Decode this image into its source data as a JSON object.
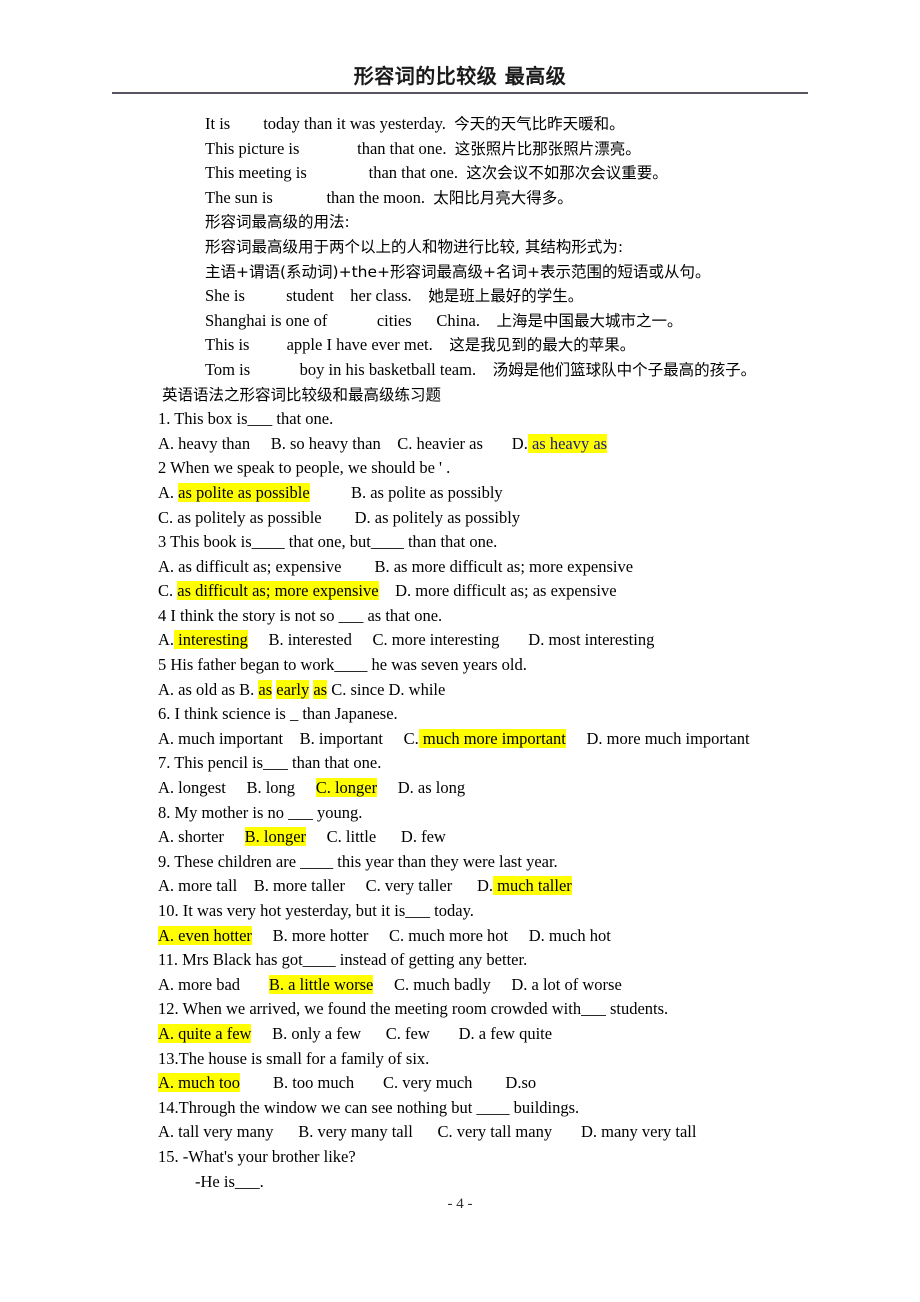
{
  "document": {
    "title": "形容词的比较级  最高级",
    "footer": "- 4 -"
  },
  "examples_comparative": [
    {
      "en_pre": "It is",
      "blank": "        ",
      "en_post": "today than it was yesterday.",
      "zh": "今天的天气比昨天暖和。"
    },
    {
      "en_pre": "This picture is",
      "blank": "              ",
      "en_post": "than that one.",
      "zh": "这张照片比那张照片漂亮。"
    },
    {
      "en_pre": "This meeting is",
      "blank": "               ",
      "en_post": "than that one.",
      "zh": "这次会议不如那次会议重要。"
    },
    {
      "en_pre": "The sun is",
      "blank": "             ",
      "en_post": "than the moon.",
      "zh": "太阳比月亮大得多。"
    }
  ],
  "notes": [
    "形容词最高级的用法:",
    "形容词最高级用于两个以上的人和物进行比较, 其结构形式为:",
    "主语+谓语(系动词)+the+形容词最高级+名词+表示范围的短语或从句。"
  ],
  "examples_superlative": [
    {
      "en_pre": "She is",
      "blank": "          ",
      "en_mid": "student",
      "blank2": "    ",
      "en_post": "her class.",
      "zh": "她是班上最好的学生。"
    },
    {
      "en_pre": "Shanghai is one of",
      "blank": "            ",
      "en_mid": "cities",
      "blank2": "      ",
      "en_post": "China.",
      "zh": "上海是中国最大城市之一。"
    },
    {
      "en_pre": "This is",
      "blank": "         ",
      "en_mid": "apple I have ever met.",
      "blank2": "",
      "en_post": "",
      "zh": "这是我见到的最大的苹果。"
    },
    {
      "en_pre": "Tom is",
      "blank": "            ",
      "en_mid": "boy in his basketball team.",
      "blank2": "",
      "en_post": "",
      "zh": "汤姆是他们篮球队中个子最高的孩子。"
    }
  ],
  "exercise_heading": "英语语法之形容词比较级和最高级练习题",
  "questions": [
    {
      "stem": "1. This box is___ that one.",
      "options_line": [
        {
          "text": "A. heavy than",
          "hl": "none"
        },
        {
          "text": "     ",
          "hl": "none"
        },
        {
          "text": "B. so heavy than",
          "hl": "none"
        },
        {
          "text": "    ",
          "hl": "none"
        },
        {
          "text": "C. heavier as",
          "hl": "none"
        },
        {
          "text": "       ",
          "hl": "none"
        },
        {
          "text": "D.",
          "hl": "none"
        },
        {
          "text": " as heavy as",
          "hl": "blue"
        }
      ]
    },
    {
      "stem": "2 When we speak to people, we should be ' .",
      "options_line": [
        {
          "text": "A. ",
          "hl": "none"
        },
        {
          "text": "as polite as possible",
          "hl": "yellow"
        },
        {
          "text": "          ",
          "hl": "none"
        },
        {
          "text": "B. as polite as possibly",
          "hl": "none"
        }
      ]
    },
    {
      "stem": "",
      "options_line": [
        {
          "text": "C. as politely as possible",
          "hl": "none"
        },
        {
          "text": "        ",
          "hl": "none"
        },
        {
          "text": "D. as politely as possibly",
          "hl": "none"
        }
      ]
    },
    {
      "stem": "3 This book is____ that one, but____ than that one.",
      "options_line": [
        {
          "text": "A. as difficult as; expensive",
          "hl": "none"
        },
        {
          "text": "        ",
          "hl": "none"
        },
        {
          "text": "B. as more difficult as; more expensive",
          "hl": "none"
        }
      ]
    },
    {
      "stem": "",
      "options_line": [
        {
          "text": "C. ",
          "hl": "none"
        },
        {
          "text": "as difficult as; more expensive",
          "hl": "yellow"
        },
        {
          "text": "    ",
          "hl": "none"
        },
        {
          "text": "D. more difficult as; as expensive",
          "hl": "none"
        }
      ]
    },
    {
      "stem": "4 I think the story is not so ___ as that one.",
      "options_line": [
        {
          "text": "A.",
          "hl": "none"
        },
        {
          "text": " interesting",
          "hl": "yellow"
        },
        {
          "text": "     ",
          "hl": "none"
        },
        {
          "text": "B. interested",
          "hl": "none"
        },
        {
          "text": "     ",
          "hl": "none"
        },
        {
          "text": "C. more interesting",
          "hl": "none"
        },
        {
          "text": "       ",
          "hl": "none"
        },
        {
          "text": "D. most interesting",
          "hl": "none"
        }
      ]
    },
    {
      "stem": "5 His father began to work____ he was seven years old.",
      "options_line": [
        {
          "text": "A. as old as B. ",
          "hl": "none"
        },
        {
          "text": "as",
          "hl": "yellow"
        },
        {
          "text": " ",
          "hl": "none"
        },
        {
          "text": "early",
          "hl": "yellow"
        },
        {
          "text": " ",
          "hl": "none"
        },
        {
          "text": "as",
          "hl": "yellow"
        },
        {
          "text": " C. since D. while",
          "hl": "none"
        }
      ]
    },
    {
      "stem": "6. I think science is _ than Japanese.",
      "options_line": [
        {
          "text": "A. much important",
          "hl": "none"
        },
        {
          "text": "    ",
          "hl": "none"
        },
        {
          "text": "B. important",
          "hl": "none"
        },
        {
          "text": "     ",
          "hl": "none"
        },
        {
          "text": "C.",
          "hl": "none"
        },
        {
          "text": " much more important",
          "hl": "yellow"
        },
        {
          "text": "     ",
          "hl": "none"
        },
        {
          "text": "D. more much important",
          "hl": "none"
        }
      ]
    },
    {
      "stem": "7. This pencil is___ than that one.",
      "options_line": [
        {
          "text": "A. longest",
          "hl": "none"
        },
        {
          "text": "     ",
          "hl": "none"
        },
        {
          "text": "B. long",
          "hl": "none"
        },
        {
          "text": "     ",
          "hl": "none"
        },
        {
          "text": "C. longer",
          "hl": "yellow"
        },
        {
          "text": "     ",
          "hl": "none"
        },
        {
          "text": "D. as long",
          "hl": "none"
        }
      ]
    },
    {
      "stem": "8. My mother is no ___ young.",
      "options_line": [
        {
          "text": "A. shorter",
          "hl": "none"
        },
        {
          "text": "     ",
          "hl": "none"
        },
        {
          "text": "B. longer",
          "hl": "yellow"
        },
        {
          "text": "     ",
          "hl": "none"
        },
        {
          "text": "C. little",
          "hl": "none"
        },
        {
          "text": "      ",
          "hl": "none"
        },
        {
          "text": "D. few",
          "hl": "none"
        }
      ]
    },
    {
      "stem": "9. These children are ____ this year than they were last year.",
      "options_line": [
        {
          "text": "A. more tall",
          "hl": "none"
        },
        {
          "text": "    ",
          "hl": "none"
        },
        {
          "text": "B. more taller",
          "hl": "none"
        },
        {
          "text": "     ",
          "hl": "none"
        },
        {
          "text": "C. very taller",
          "hl": "none"
        },
        {
          "text": "      ",
          "hl": "none"
        },
        {
          "text": "D.",
          "hl": "none"
        },
        {
          "text": " much taller",
          "hl": "yellow"
        }
      ]
    },
    {
      "stem": "10. It was very hot yesterday, but it is___ today.",
      "options_line": [
        {
          "text": "A. even hotter",
          "hl": "yellow"
        },
        {
          "text": "     ",
          "hl": "none"
        },
        {
          "text": "B. more hotter",
          "hl": "none"
        },
        {
          "text": "     ",
          "hl": "none"
        },
        {
          "text": "C. much more hot",
          "hl": "none"
        },
        {
          "text": "     ",
          "hl": "none"
        },
        {
          "text": "D. much hot",
          "hl": "none"
        }
      ]
    },
    {
      "stem": "11. Mrs Black has got____ instead of getting any better.",
      "options_line": [
        {
          "text": "A. more bad",
          "hl": "none"
        },
        {
          "text": "       ",
          "hl": "none"
        },
        {
          "text": "B. a little worse",
          "hl": "yellow"
        },
        {
          "text": "     ",
          "hl": "none"
        },
        {
          "text": "C. much badly",
          "hl": "none"
        },
        {
          "text": "     ",
          "hl": "none"
        },
        {
          "text": "D. a lot of worse",
          "hl": "none"
        }
      ]
    },
    {
      "stem": "12. When we arrived, we found the meeting room crowded with___ students.",
      "options_line": [
        {
          "text": "A. quite a few",
          "hl": "yellow"
        },
        {
          "text": "     ",
          "hl": "none"
        },
        {
          "text": "B. only a few",
          "hl": "none"
        },
        {
          "text": "      ",
          "hl": "none"
        },
        {
          "text": "C. few",
          "hl": "none"
        },
        {
          "text": "       ",
          "hl": "none"
        },
        {
          "text": "D. a few quite",
          "hl": "none"
        }
      ]
    },
    {
      "stem": "13.The house is small for a family of six.",
      "options_line": [
        {
          "text": "A. much too",
          "hl": "yellow"
        },
        {
          "text": "        ",
          "hl": "none"
        },
        {
          "text": "B. too much",
          "hl": "none"
        },
        {
          "text": "       ",
          "hl": "none"
        },
        {
          "text": "C. very much",
          "hl": "none"
        },
        {
          "text": "        ",
          "hl": "none"
        },
        {
          "text": "D.so",
          "hl": "none"
        }
      ]
    },
    {
      "stem": "14.Through the window we can see nothing but ____ buildings.",
      "options_line": [
        {
          "text": "A. tall very many",
          "hl": "none"
        },
        {
          "text": "      ",
          "hl": "none"
        },
        {
          "text": "B. very many tall",
          "hl": "none"
        },
        {
          "text": "      ",
          "hl": "none"
        },
        {
          "text": "C. very tall many",
          "hl": "none"
        },
        {
          "text": "       ",
          "hl": "none"
        },
        {
          "text": "D. many very tall",
          "hl": "none"
        }
      ]
    },
    {
      "stem": "15. -What's your brother like?",
      "options_line": []
    }
  ],
  "last_line": "-He is___."
}
